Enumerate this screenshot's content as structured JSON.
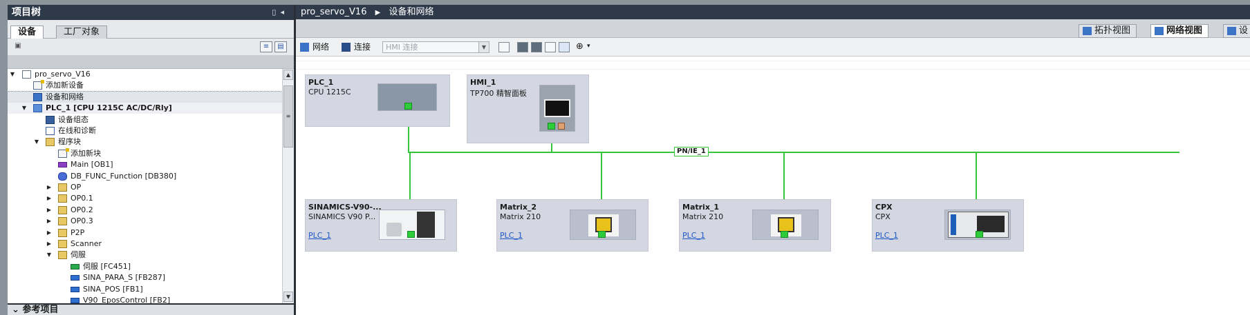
{
  "project_tree": {
    "title": "项目树",
    "tabs": [
      "设备",
      "工厂对象"
    ],
    "items": [
      {
        "label": "pro_servo_V16",
        "indent": 0,
        "expanded": true,
        "icon": "project-icon"
      },
      {
        "label": "添加新设备",
        "indent": 1,
        "icon": "add-device-icon"
      },
      {
        "label": "设备和网络",
        "indent": 1,
        "icon": "network-icon",
        "selected": true
      },
      {
        "label": "PLC_1 [CPU 1215C AC/DC/Rly]",
        "indent": 1,
        "expanded": true,
        "icon": "plc-icon",
        "bold": true
      },
      {
        "label": "设备组态",
        "indent": 2,
        "icon": "device-config-icon"
      },
      {
        "label": "在线和诊断",
        "indent": 2,
        "icon": "online-diagnostics-icon"
      },
      {
        "label": "程序块",
        "indent": 2,
        "expanded": true,
        "icon": "folder-icon"
      },
      {
        "label": "添加新块",
        "indent": 3,
        "icon": "add-block-icon"
      },
      {
        "label": "Main [OB1]",
        "indent": 3,
        "icon": "ob-block-icon"
      },
      {
        "label": "DB_FUNC_Function [DB380]",
        "indent": 3,
        "icon": "db-block-icon"
      },
      {
        "label": "OP",
        "indent": 3,
        "collapsed": true,
        "icon": "folder-icon"
      },
      {
        "label": "OP0.1",
        "indent": 3,
        "collapsed": true,
        "icon": "folder-icon"
      },
      {
        "label": "OP0.2",
        "indent": 3,
        "collapsed": true,
        "icon": "folder-icon"
      },
      {
        "label": "OP0.3",
        "indent": 3,
        "collapsed": true,
        "icon": "folder-icon"
      },
      {
        "label": "P2P",
        "indent": 3,
        "collapsed": true,
        "icon": "folder-icon"
      },
      {
        "label": "Scanner",
        "indent": 3,
        "collapsed": true,
        "icon": "folder-icon"
      },
      {
        "label": "伺服",
        "indent": 3,
        "expanded": true,
        "icon": "folder-icon"
      },
      {
        "label": "伺服 [FC451]",
        "indent": 4,
        "icon": "fc-block-icon"
      },
      {
        "label": "SINA_PARA_S [FB287]",
        "indent": 4,
        "icon": "fb-block-icon"
      },
      {
        "label": "SINA_POS [FB1]",
        "indent": 4,
        "icon": "fb-block-icon"
      },
      {
        "label": "V90_EposControl [FB2]",
        "indent": 4,
        "icon": "fb-block-icon"
      }
    ],
    "bottom_section": "参考项目"
  },
  "editor": {
    "breadcrumb": [
      "pro_servo_V16",
      "设备和网络"
    ],
    "view_tabs": [
      "拓扑视图",
      "网络视图",
      "设"
    ],
    "toolbar": {
      "network_label": "网络",
      "connection_label": "连接",
      "connection_type_placeholder": "HMI 连接"
    },
    "network_name": "PN/IE_1",
    "devices": [
      {
        "name": "PLC_1",
        "type": "CPU 1215C",
        "link": ""
      },
      {
        "name": "HMI_1",
        "type": "TP700 精智面板",
        "link": ""
      },
      {
        "name": "SINAMICS-V90-...",
        "type": "SINAMICS V90 P...",
        "link": "PLC_1"
      },
      {
        "name": "Matrix_2",
        "type": "Matrix 210",
        "link": "PLC_1"
      },
      {
        "name": "Matrix_1",
        "type": "Matrix 210",
        "link": "PLC_1"
      },
      {
        "name": "CPX",
        "type": "CPX",
        "link": "PLC_1"
      }
    ],
    "colors": {
      "title_bar": "#2e3a4a",
      "network_line": "#33c43a",
      "device_box": "#d4d7e1",
      "link": "#1b56c8"
    }
  }
}
